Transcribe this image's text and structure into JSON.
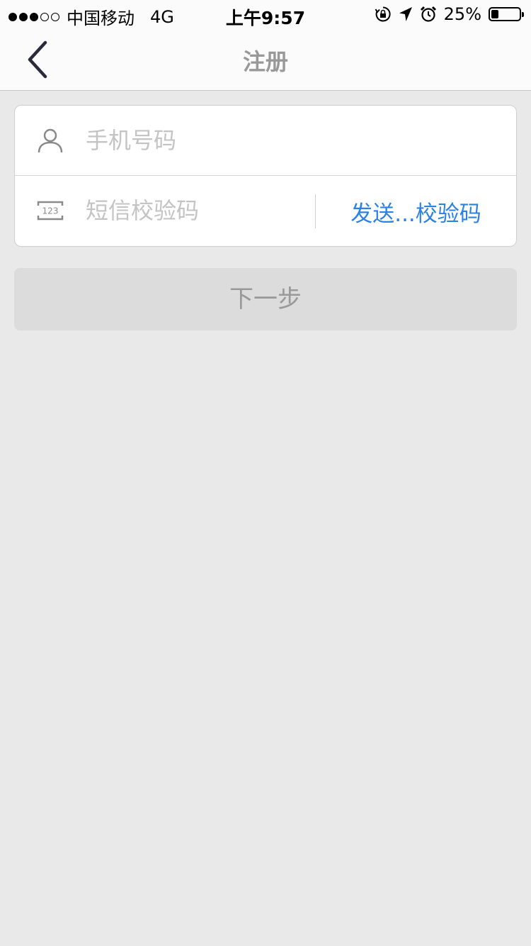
{
  "status_bar": {
    "carrier": "中国移动",
    "network": "4G",
    "time": "上午9:57",
    "battery": "25%",
    "battery_level": 0.25,
    "signal_bars_filled": 3,
    "signal_bars_total": 5
  },
  "nav": {
    "title": "注册",
    "back_icon": "chevron-left-icon"
  },
  "form": {
    "phone": {
      "placeholder": "手机号码",
      "value": "",
      "icon": "user-icon"
    },
    "sms_code": {
      "placeholder": "短信校验码",
      "value": "",
      "icon": "keypad-123-icon",
      "icon_text": "123",
      "send_label": "发送...校验码"
    }
  },
  "next_button": {
    "label": "下一步"
  },
  "colors": {
    "accent": "#2b82e4",
    "background": "#e9e9e9",
    "disabled_button": "#dcdcdc"
  }
}
